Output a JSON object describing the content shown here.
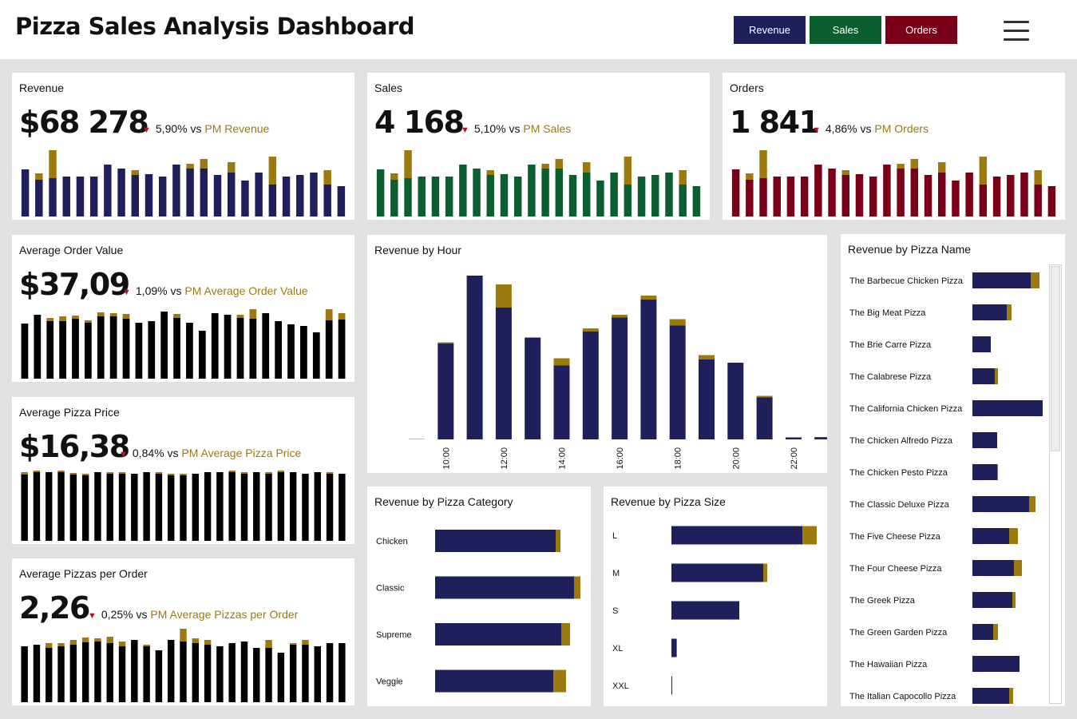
{
  "header": {
    "title": "Pizza Sales Analysis Dashboard",
    "buttons": [
      {
        "label": "Revenue",
        "color": "#1f1f5c"
      },
      {
        "label": "Sales",
        "color": "#0b5e2e"
      },
      {
        "label": "Orders",
        "color": "#7a0019"
      }
    ],
    "menu_icon": "hamburger-menu-icon"
  },
  "colors": {
    "revenue": "#1f1f5c",
    "sales": "#0b5e2e",
    "orders": "#7a0019",
    "neutral": "#000000",
    "comparison": "#9c7a0e",
    "down_arrow": "#b0142a"
  },
  "kpis": {
    "revenue": {
      "title": "Revenue",
      "value": "$68 278",
      "arrow": "▼",
      "delta": "5,90% vs",
      "pm_label": "PM Revenue"
    },
    "sales": {
      "title": "Sales",
      "value": "4 168",
      "arrow": "▼",
      "delta": "5,10% vs",
      "pm_label": "PM Sales"
    },
    "orders": {
      "title": "Orders",
      "value": "1 841",
      "arrow": "▼",
      "delta": "4,86% vs",
      "pm_label": "PM Orders"
    },
    "aov": {
      "title": "Average Order Value",
      "value": "$37,09",
      "arrow": "▼",
      "delta": "1,09% vs",
      "pm_label": "PM Average Order Value"
    },
    "app": {
      "title": "Average Pizza Price",
      "value": "$16,38",
      "arrow": "▼",
      "delta": "0,84% vs",
      "pm_label": "PM Average Pizza Price"
    },
    "ppo": {
      "title": "Average Pizzas per Order",
      "value": "2,26",
      "arrow": "▼",
      "delta": "0,25% vs",
      "pm_label": "PM Average Pizzas per Order"
    }
  },
  "chart_data": [
    {
      "id": "revenue_by_hour",
      "type": "bar",
      "title": "Revenue by Hour",
      "categories": [
        "9",
        "10",
        "11",
        "12",
        "13",
        "14",
        "15",
        "16",
        "17",
        "18",
        "19",
        "20",
        "21",
        "22",
        "23"
      ],
      "tick_labels": [
        "10:00",
        "12:00",
        "14:00",
        "16:00",
        "18:00",
        "20:00",
        "22:00"
      ],
      "series": [
        {
          "values": [
            0,
            240,
            410,
            330,
            255,
            185,
            270,
            305,
            350,
            285,
            200,
            192,
            105,
            5,
            5
          ]
        },
        {
          "values": [
            1,
            3,
            0,
            58,
            0,
            18,
            8,
            7,
            10,
            16,
            11,
            0,
            4,
            0,
            1
          ]
        }
      ]
    },
    {
      "id": "revenue_by_pizza_category",
      "type": "bar",
      "orientation": "horizontal",
      "title": "Revenue by Pizza Category",
      "categories": [
        "Chicken",
        "Classic",
        "Supreme",
        "Veggie"
      ],
      "series": [
        {
          "values": [
            151,
            174,
            158,
            148
          ]
        },
        {
          "values": [
            6,
            8,
            11,
            16
          ]
        }
      ]
    },
    {
      "id": "revenue_by_pizza_size",
      "type": "bar",
      "orientation": "horizontal",
      "title": "Revenue by Pizza Size",
      "categories": [
        "L",
        "M",
        "S",
        "XL",
        "XXL"
      ],
      "series": [
        {
          "values": [
            164,
            115,
            85,
            6,
            1
          ]
        },
        {
          "values": [
            18,
            5,
            0,
            1,
            0
          ]
        }
      ]
    },
    {
      "id": "revenue_by_pizza_name",
      "type": "bar",
      "orientation": "horizontal",
      "title": "Revenue by Pizza Name",
      "categories": [
        "The Barbecue Chicken Pizza",
        "The Big Meat Pizza",
        "The Brie Carre Pizza",
        "The Calabrese Pizza",
        "The California Chicken Pizza",
        "The Chicken Alfredo Pizza",
        "The Chicken Pesto Pizza",
        "The Classic Deluxe Pizza",
        "The Five Cheese Pizza",
        "The Four Cheese Pizza",
        "The Greek Pizza",
        "The Green Garden Pizza",
        "The Hawaiian Pizza",
        "The Italian Capocollo Pizza"
      ],
      "series": [
        {
          "values": [
            73,
            43,
            23,
            28,
            88,
            31,
            31,
            71,
            46,
            52,
            50,
            26,
            59,
            46
          ]
        },
        {
          "values": [
            11,
            6,
            0,
            4,
            0,
            0,
            1,
            8,
            11,
            10,
            4,
            6,
            0,
            5
          ]
        }
      ]
    },
    {
      "id": "revenue_trend",
      "type": "bar",
      "series": [
        {
          "values": [
            59,
            46,
            48,
            50,
            50,
            50,
            65,
            60,
            52,
            53,
            50,
            65,
            60,
            60,
            52,
            55,
            45,
            55,
            40,
            50,
            52,
            55,
            40,
            38
          ]
        },
        {
          "values": [
            0,
            8,
            35,
            0,
            0,
            0,
            0,
            0,
            6,
            0,
            0,
            0,
            6,
            12,
            0,
            13,
            0,
            0,
            35,
            0,
            0,
            0,
            18,
            0
          ]
        }
      ]
    },
    {
      "id": "sales_trend",
      "type": "bar",
      "series": [
        {
          "values": [
            59,
            46,
            48,
            50,
            50,
            50,
            65,
            60,
            52,
            53,
            50,
            65,
            60,
            60,
            52,
            55,
            45,
            55,
            40,
            50,
            52,
            55,
            40,
            38
          ]
        },
        {
          "values": [
            0,
            8,
            35,
            0,
            0,
            0,
            0,
            0,
            6,
            0,
            0,
            0,
            6,
            12,
            0,
            13,
            0,
            0,
            35,
            0,
            0,
            0,
            18,
            0
          ]
        }
      ]
    },
    {
      "id": "orders_trend",
      "type": "bar",
      "series": [
        {
          "values": [
            59,
            46,
            48,
            50,
            50,
            50,
            65,
            60,
            52,
            53,
            50,
            65,
            60,
            60,
            52,
            55,
            45,
            55,
            40,
            50,
            52,
            55,
            40,
            38
          ]
        },
        {
          "values": [
            0,
            8,
            35,
            0,
            0,
            0,
            0,
            0,
            6,
            0,
            0,
            0,
            6,
            12,
            0,
            13,
            0,
            0,
            35,
            0,
            0,
            0,
            18,
            0
          ]
        }
      ]
    },
    {
      "id": "aov_trend",
      "type": "bar",
      "series": [
        {
          "values": [
            69,
            80,
            72,
            72,
            75,
            70,
            78,
            78,
            75,
            70,
            72,
            84,
            76,
            70,
            60,
            82,
            80,
            76,
            75,
            82,
            72,
            68,
            66,
            58,
            73,
            74
          ]
        },
        {
          "values": [
            0,
            0,
            4,
            6,
            4,
            3,
            5,
            4,
            6,
            0,
            0,
            0,
            5,
            0,
            0,
            0,
            0,
            4,
            12,
            0,
            0,
            0,
            0,
            0,
            14,
            8
          ]
        }
      ]
    },
    {
      "id": "app_trend",
      "type": "bar",
      "series": [
        {
          "values": [
            83,
            86,
            86,
            86,
            83,
            82,
            86,
            84,
            84,
            84,
            86,
            84,
            82,
            82,
            84,
            86,
            86,
            86,
            84,
            86,
            84,
            86,
            86,
            84,
            86,
            84,
            84
          ]
        },
        {
          "values": [
            3,
            2,
            0,
            2,
            2,
            2,
            0,
            2,
            2,
            0,
            0,
            2,
            2,
            2,
            0,
            0,
            0,
            2,
            2,
            0,
            2,
            2,
            0,
            0,
            0,
            2,
            0
          ]
        }
      ]
    },
    {
      "id": "ppo_trend",
      "type": "bar",
      "series": [
        {
          "values": [
            70,
            72,
            68,
            70,
            72,
            75,
            76,
            74,
            70,
            78,
            70,
            65,
            78,
            76,
            74,
            72,
            70,
            74,
            76,
            68,
            68,
            62,
            72,
            72,
            70,
            74,
            74
          ]
        },
        {
          "values": [
            0,
            0,
            6,
            4,
            6,
            6,
            4,
            8,
            6,
            0,
            2,
            0,
            0,
            16,
            6,
            6,
            0,
            0,
            0,
            0,
            10,
            0,
            2,
            6,
            0,
            0,
            0
          ]
        }
      ]
    }
  ]
}
